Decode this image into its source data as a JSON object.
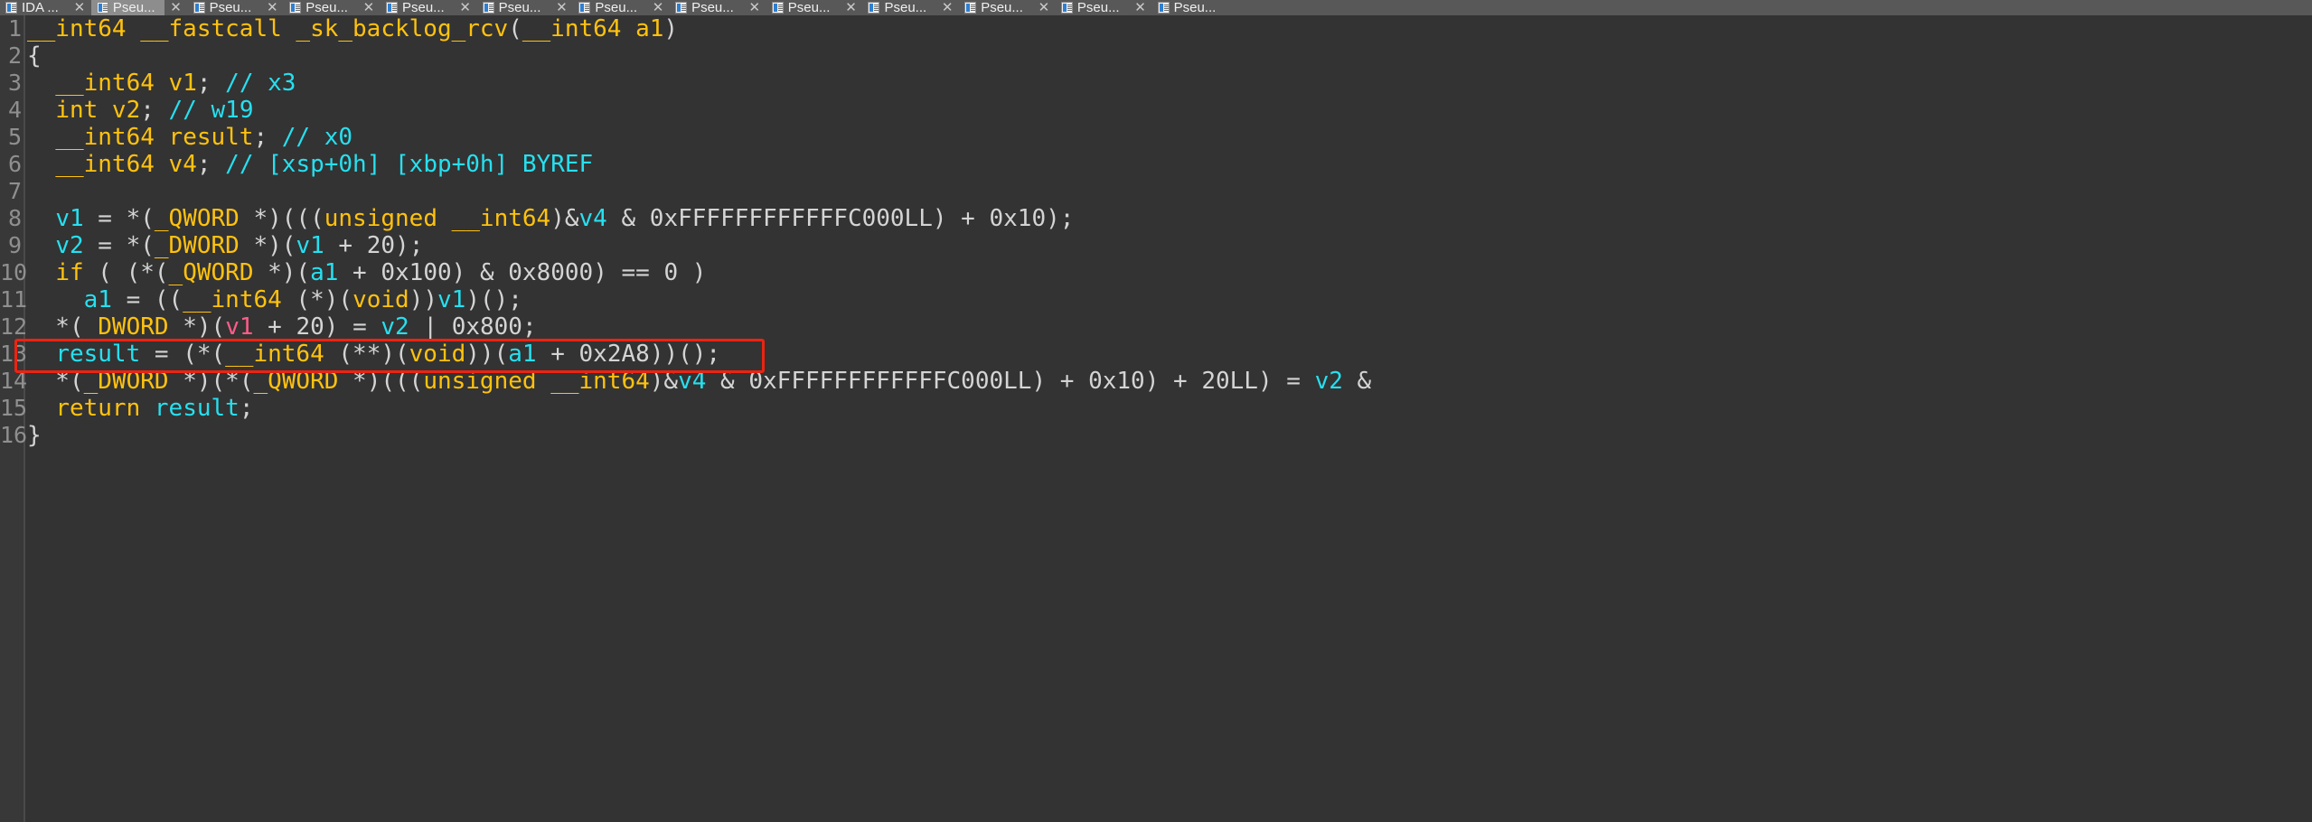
{
  "app": {
    "name": "IDA Pro",
    "view": "Pseudocode decompiler"
  },
  "tabbar": {
    "first_tab_label": "IDA ...",
    "close_glyph": "✕",
    "tabs": [
      {
        "label": "IDA ...",
        "active": false,
        "has_icon": true
      },
      {
        "label": "Pseu...",
        "active": true,
        "has_icon": true
      },
      {
        "label": "Pseu...",
        "active": false,
        "has_icon": true
      },
      {
        "label": "Pseu...",
        "active": false,
        "has_icon": true
      },
      {
        "label": "Pseu...",
        "active": false,
        "has_icon": true
      },
      {
        "label": "Pseu...",
        "active": false,
        "has_icon": true
      },
      {
        "label": "Pseu...",
        "active": false,
        "has_icon": true
      },
      {
        "label": "Pseu...",
        "active": false,
        "has_icon": true
      },
      {
        "label": "Pseu...",
        "active": false,
        "has_icon": true
      },
      {
        "label": "Pseu...",
        "active": false,
        "has_icon": true
      },
      {
        "label": "Pseu...",
        "active": false,
        "has_icon": true
      },
      {
        "label": "Pseu...",
        "active": false,
        "has_icon": true
      },
      {
        "label": "Pseu...",
        "active": false,
        "has_icon": true
      }
    ]
  },
  "colors": {
    "background": "#333333",
    "gutter": "#383838",
    "tabbar": "#585858",
    "tab_active": "#8d8d8d",
    "keyword": "#ffc20e",
    "variable": "#26e0f0",
    "comment": "#26e0f0",
    "punctuation": "#d4d4d4",
    "highlight_variable": "#ff5c8a",
    "highlight_box": "#ee2211",
    "line_number": "#8f8f8f"
  },
  "code": {
    "function_name": "_sk_backlog_rcv",
    "line_numbers": [
      "1",
      "2",
      "3",
      "4",
      "5",
      "6",
      "7",
      "8",
      "9",
      "10",
      "11",
      "12",
      "13",
      "14",
      "15",
      "16"
    ],
    "lines": [
      {
        "n": "1",
        "text": "__int64 __fastcall _sk_backlog_rcv(__int64 a1)",
        "tokens": [
          {
            "t": "__int64 __fastcall _sk_backlog_rcv",
            "c": "kw"
          },
          {
            "t": "(",
            "c": "pun"
          },
          {
            "t": "__int64",
            "c": "kw"
          },
          {
            "t": " a1",
            "c": "kw"
          },
          {
            "t": ")",
            "c": "pun"
          }
        ]
      },
      {
        "n": "2",
        "text": "{",
        "tokens": [
          {
            "t": "{",
            "c": "pun"
          }
        ]
      },
      {
        "n": "3",
        "text": "  __int64 v1; // x3",
        "tokens": [
          {
            "t": "  ",
            "c": "pun"
          },
          {
            "t": "__int64 v1",
            "c": "kw"
          },
          {
            "t": ";",
            "c": "pun"
          },
          {
            "t": " ",
            "c": "pun"
          },
          {
            "t": "// x3",
            "c": "cmt"
          }
        ]
      },
      {
        "n": "4",
        "text": "  int v2; // w19",
        "tokens": [
          {
            "t": "  ",
            "c": "pun"
          },
          {
            "t": "int v2",
            "c": "kw"
          },
          {
            "t": ";",
            "c": "pun"
          },
          {
            "t": " ",
            "c": "pun"
          },
          {
            "t": "// w19",
            "c": "cmt"
          }
        ]
      },
      {
        "n": "5",
        "text": "  __int64 result; // x0",
        "tokens": [
          {
            "t": "  ",
            "c": "pun"
          },
          {
            "t": "__int64 result",
            "c": "kw"
          },
          {
            "t": ";",
            "c": "pun"
          },
          {
            "t": " ",
            "c": "pun"
          },
          {
            "t": "// x0",
            "c": "cmt"
          }
        ]
      },
      {
        "n": "6",
        "text": "  __int64 v4; // [xsp+0h] [xbp+0h] BYREF",
        "tokens": [
          {
            "t": "  ",
            "c": "pun"
          },
          {
            "t": "__int64 v4",
            "c": "kw"
          },
          {
            "t": ";",
            "c": "pun"
          },
          {
            "t": " ",
            "c": "pun"
          },
          {
            "t": "// [xsp+0h] [xbp+0h] BYREF",
            "c": "cmt"
          }
        ]
      },
      {
        "n": "7",
        "text": "",
        "tokens": []
      },
      {
        "n": "8",
        "text": "  v1 = *(_QWORD *)(((unsigned __int64)&v4 & 0xFFFFFFFFFFFFC000LL) + 0x10);",
        "tokens": [
          {
            "t": "  ",
            "c": "pun"
          },
          {
            "t": "v1",
            "c": "var"
          },
          {
            "t": " = *(",
            "c": "pun"
          },
          {
            "t": "_QWORD",
            "c": "kw"
          },
          {
            "t": " *)(((",
            "c": "pun"
          },
          {
            "t": "unsigned __int64",
            "c": "kw"
          },
          {
            "t": ")&",
            "c": "pun"
          },
          {
            "t": "v4",
            "c": "var"
          },
          {
            "t": " & ",
            "c": "pun"
          },
          {
            "t": "0xFFFFFFFFFFFFC000LL",
            "c": "num"
          },
          {
            "t": ") + ",
            "c": "pun"
          },
          {
            "t": "0x10",
            "c": "num"
          },
          {
            "t": ");",
            "c": "pun"
          }
        ]
      },
      {
        "n": "9",
        "text": "  v2 = *(_DWORD *)(v1 + 20);",
        "tokens": [
          {
            "t": "  ",
            "c": "pun"
          },
          {
            "t": "v2",
            "c": "var"
          },
          {
            "t": " = *(",
            "c": "pun"
          },
          {
            "t": "_DWORD",
            "c": "kw"
          },
          {
            "t": " *)(",
            "c": "pun"
          },
          {
            "t": "v1",
            "c": "var"
          },
          {
            "t": " + ",
            "c": "pun"
          },
          {
            "t": "20",
            "c": "num"
          },
          {
            "t": ");",
            "c": "pun"
          }
        ]
      },
      {
        "n": "10",
        "text": "  if ( *(_QWORD *)(a1 + 0x100) & 0x8000) == 0 )",
        "tokens": [
          {
            "t": "  ",
            "c": "pun"
          },
          {
            "t": "if",
            "c": "kw"
          },
          {
            "t": " ( (*(",
            "c": "pun"
          },
          {
            "t": "_QWORD",
            "c": "kw"
          },
          {
            "t": " *)(",
            "c": "pun"
          },
          {
            "t": "a1",
            "c": "var"
          },
          {
            "t": " + ",
            "c": "pun"
          },
          {
            "t": "0x100",
            "c": "num"
          },
          {
            "t": ") & ",
            "c": "pun"
          },
          {
            "t": "0x8000",
            "c": "num"
          },
          {
            "t": ") == ",
            "c": "pun"
          },
          {
            "t": "0",
            "c": "num"
          },
          {
            "t": " )",
            "c": "pun"
          }
        ]
      },
      {
        "n": "11",
        "text": "    a1 = ((__int64 (*)(void))v1)();",
        "tokens": [
          {
            "t": "    ",
            "c": "pun"
          },
          {
            "t": "a1",
            "c": "var"
          },
          {
            "t": " = ((",
            "c": "pun"
          },
          {
            "t": "__int64",
            "c": "kw"
          },
          {
            "t": " (*)(",
            "c": "pun"
          },
          {
            "t": "void",
            "c": "kw"
          },
          {
            "t": "))",
            "c": "pun"
          },
          {
            "t": "v1",
            "c": "var"
          },
          {
            "t": ")();",
            "c": "pun"
          }
        ]
      },
      {
        "n": "12",
        "text": "  *(_DWORD *)(v1 + 20) = v2 | 0x800;",
        "tokens": [
          {
            "t": "  *( ",
            "c": "pun"
          },
          {
            "t": "DWORD",
            "c": "kw"
          },
          {
            "t": " *)(",
            "c": "pun"
          },
          {
            "t": "v1",
            "c": "pink"
          },
          {
            "t": " + ",
            "c": "pun"
          },
          {
            "t": "20",
            "c": "num"
          },
          {
            "t": ") = ",
            "c": "pun"
          },
          {
            "t": "v2",
            "c": "var"
          },
          {
            "t": " | ",
            "c": "pun"
          },
          {
            "t": "0x800",
            "c": "num"
          },
          {
            "t": ";",
            "c": "pun"
          }
        ]
      },
      {
        "n": "13",
        "text": "  result = (*(__int64 (**)(void))(a1 + 0x2A8))();",
        "highlighted": true,
        "tokens": [
          {
            "t": "  ",
            "c": "pun"
          },
          {
            "t": "result",
            "c": "var"
          },
          {
            "t": " = (*(",
            "c": "pun"
          },
          {
            "t": "__int64",
            "c": "kw"
          },
          {
            "t": " (**)(",
            "c": "pun"
          },
          {
            "t": "void",
            "c": "kw"
          },
          {
            "t": "))(",
            "c": "pun"
          },
          {
            "t": "a1",
            "c": "var"
          },
          {
            "t": " + ",
            "c": "pun"
          },
          {
            "t": "0x2A8",
            "c": "num"
          },
          {
            "t": "))();",
            "c": "pun"
          }
        ]
      },
      {
        "n": "14",
        "text": "  *(_DWORD *)(*(_QWORD *)(((unsigned __int64)&v4 & 0xFFFFFFFFFFFFC000LL) + 0x10) + 20LL) = v2 &",
        "tokens": [
          {
            "t": "  *(",
            "c": "pun"
          },
          {
            "t": "_DWORD",
            "c": "kw"
          },
          {
            "t": " *)(*(",
            "c": "pun"
          },
          {
            "t": "_QWORD",
            "c": "kw"
          },
          {
            "t": " *)(((",
            "c": "pun"
          },
          {
            "t": "unsigned __int64",
            "c": "kw"
          },
          {
            "t": ")&",
            "c": "pun"
          },
          {
            "t": "v4",
            "c": "var"
          },
          {
            "t": " & ",
            "c": "pun"
          },
          {
            "t": "0xFFFFFFFFFFFFC000LL",
            "c": "num"
          },
          {
            "t": ") + ",
            "c": "pun"
          },
          {
            "t": "0x10",
            "c": "num"
          },
          {
            "t": ") + ",
            "c": "pun"
          },
          {
            "t": "20LL",
            "c": "num"
          },
          {
            "t": ") = ",
            "c": "pun"
          },
          {
            "t": "v2",
            "c": "var"
          },
          {
            "t": " &",
            "c": "pun"
          }
        ]
      },
      {
        "n": "15",
        "text": "  return result;",
        "tokens": [
          {
            "t": "  ",
            "c": "pun"
          },
          {
            "t": "return",
            "c": "kw"
          },
          {
            "t": " result",
            "c": "var"
          },
          {
            "t": ";",
            "c": "pun"
          }
        ]
      },
      {
        "n": "16",
        "text": "}",
        "tokens": [
          {
            "t": "}",
            "c": "pun"
          }
        ]
      }
    ]
  },
  "highlight": {
    "line_number": "13",
    "label": "red-annotation-box",
    "color": "#ee2211"
  }
}
